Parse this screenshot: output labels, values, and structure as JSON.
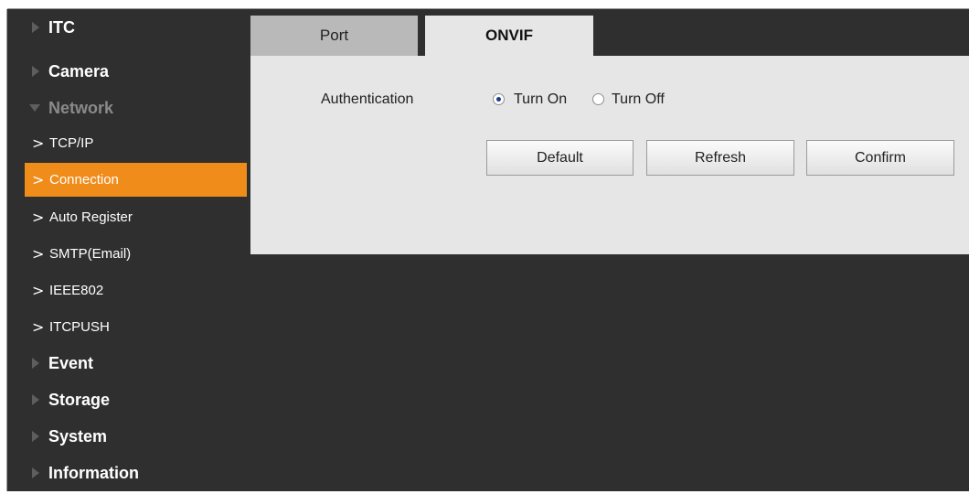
{
  "sidebar": {
    "items": [
      {
        "label": "ITC"
      },
      {
        "label": "Camera"
      },
      {
        "label": "Network"
      },
      {
        "label": "Event"
      },
      {
        "label": "Storage"
      },
      {
        "label": "System"
      },
      {
        "label": "Information"
      }
    ],
    "network_sub": [
      {
        "label": "TCP/IP"
      },
      {
        "label": "Connection"
      },
      {
        "label": "Auto Register"
      },
      {
        "label": "SMTP(Email)"
      },
      {
        "label": "IEEE802"
      },
      {
        "label": "ITCPUSH"
      }
    ],
    "chevron": ">",
    "active_color": "#f08c1a"
  },
  "tabs": [
    {
      "label": "Port"
    },
    {
      "label": "ONVIF"
    }
  ],
  "form": {
    "auth_label": "Authentication",
    "turn_on_label": "Turn On",
    "turn_off_label": "Turn Off",
    "selected": "Turn On"
  },
  "buttons": {
    "default": "Default",
    "refresh": "Refresh",
    "confirm": "Confirm"
  },
  "icons": {
    "collapsed": "triangle-right-icon",
    "expanded": "triangle-down-icon",
    "submenu": "chevron-right-icon"
  }
}
